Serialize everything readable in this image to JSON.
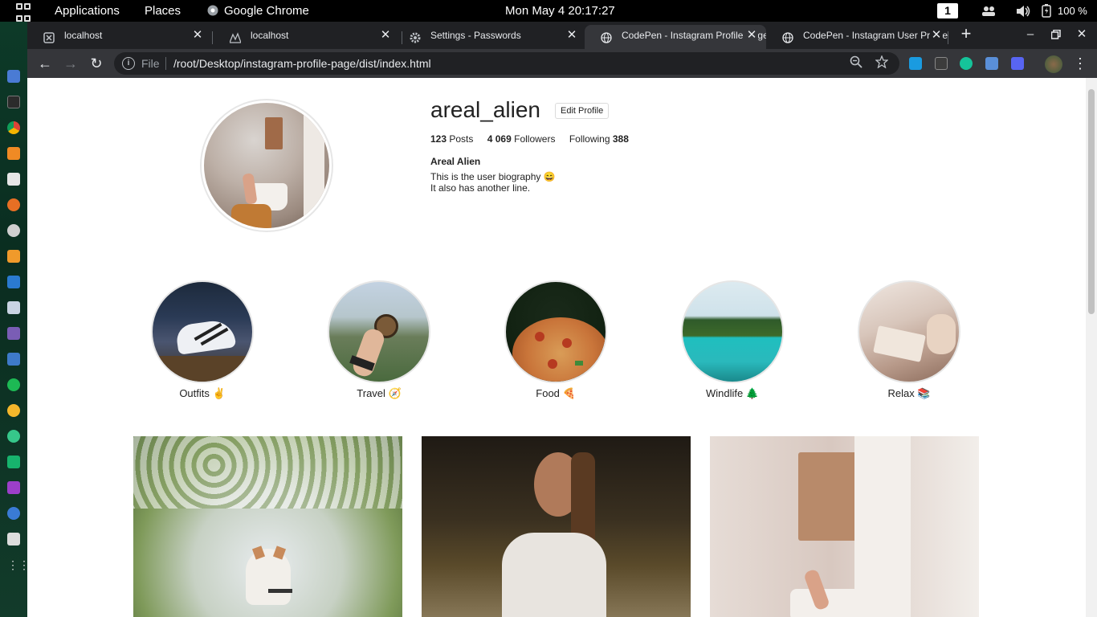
{
  "topbar": {
    "applications": "Applications",
    "places": "Places",
    "app_name": "Google Chrome",
    "clock": "Mon May 4  20:17:27",
    "workspace": "1",
    "battery": "100 %"
  },
  "tabs": [
    {
      "title": "localhost"
    },
    {
      "title": "localhost"
    },
    {
      "title": "Settings - Passwords"
    },
    {
      "title": "CodePen - Instagram Profile Page"
    },
    {
      "title": "CodePen - Instagram User Profile"
    }
  ],
  "omnibox": {
    "scheme_label": "File",
    "url": "/root/Desktop/instagram-profile-page/dist/index.html"
  },
  "profile": {
    "username": "areal_alien",
    "edit_label": "Edit Profile",
    "posts_count": "123",
    "posts_label": "Posts",
    "followers_count": "4 069",
    "followers_label": "Followers",
    "following_label": "Following",
    "following_count": "388",
    "full_name": "Areal Alien",
    "bio_line1": "This is the user biography 😄",
    "bio_line2": "It also has another line."
  },
  "highlights": [
    {
      "label": "Outfits ✌"
    },
    {
      "label": "Travel 🧭"
    },
    {
      "label": "Food 🍕"
    },
    {
      "label": "Windlife 🌲"
    },
    {
      "label": "Relax 📚"
    }
  ],
  "colors": {
    "chrome_dark": "#202124",
    "chrome_toolbar": "#35363a",
    "page_bg": "#ffffff"
  }
}
